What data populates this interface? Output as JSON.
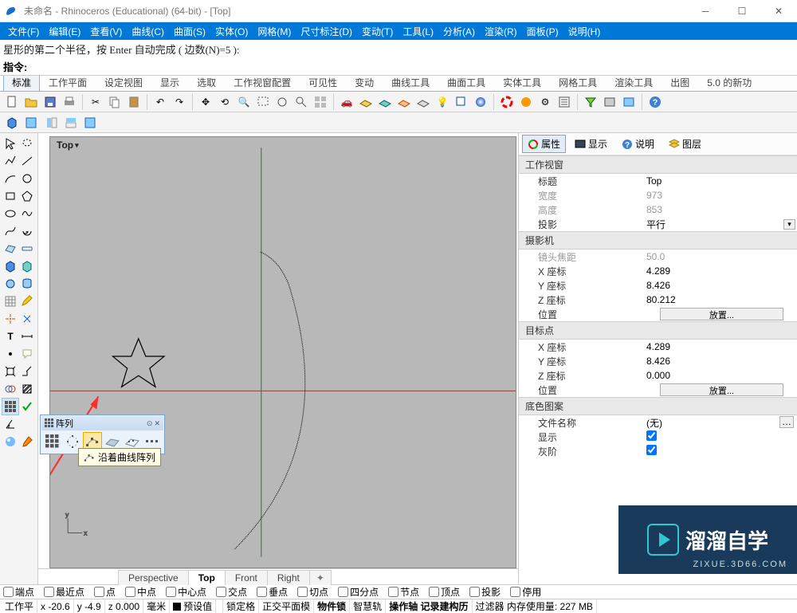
{
  "window": {
    "title": "未命名 - Rhinoceros (Educational) (64-bit) - [Top]"
  },
  "menu": [
    "文件(F)",
    "编辑(E)",
    "查看(V)",
    "曲线(C)",
    "曲面(S)",
    "实体(O)",
    "网格(M)",
    "尺寸标注(D)",
    "变动(T)",
    "工具(L)",
    "分析(A)",
    "渲染(R)",
    "面板(P)",
    "说明(H)"
  ],
  "command": {
    "prompt": "星形的第二个半径，按 Enter 自动完成 ( 边数(N)=5 ):",
    "label": "指令:"
  },
  "tabs": [
    "标准",
    "工作平面",
    "设定视图",
    "显示",
    "选取",
    "工作视窗配置",
    "可见性",
    "变动",
    "曲线工具",
    "曲面工具",
    "实体工具",
    "网格工具",
    "渲染工具",
    "出图",
    "5.0 的新功"
  ],
  "active_tab": 0,
  "viewport": {
    "label": "Top"
  },
  "view_tabs": [
    "Perspective",
    "Top",
    "Front",
    "Right"
  ],
  "active_view_tab": 1,
  "float_toolbar": {
    "title": "阵列",
    "tooltip": "沿着曲线阵列"
  },
  "right_panel": {
    "tabs": [
      "属性",
      "显示",
      "说明",
      "图层"
    ],
    "active": 0,
    "groups": [
      {
        "title": "工作视窗",
        "rows": [
          {
            "k": "标题",
            "v": "Top"
          },
          {
            "k": "宽度",
            "v": "973",
            "dim": true
          },
          {
            "k": "高度",
            "v": "853",
            "dim": true
          },
          {
            "k": "投影",
            "v": "平行",
            "combo": true
          }
        ]
      },
      {
        "title": "摄影机",
        "rows": [
          {
            "k": "镜头焦距",
            "v": "50.0",
            "dim": true
          },
          {
            "k": "X 座标",
            "v": "4.289"
          },
          {
            "k": "Y 座标",
            "v": "8.426"
          },
          {
            "k": "Z 座标",
            "v": "80.212"
          },
          {
            "k": "位置",
            "btn": "放置..."
          }
        ]
      },
      {
        "title": "目标点",
        "rows": [
          {
            "k": "X 座标",
            "v": "4.289"
          },
          {
            "k": "Y 座标",
            "v": "8.426"
          },
          {
            "k": "Z 座标",
            "v": "0.000"
          },
          {
            "k": "位置",
            "btn": "放置..."
          }
        ]
      },
      {
        "title": "底色图案",
        "rows": [
          {
            "k": "文件名称",
            "v": "(无)",
            "dots": true
          },
          {
            "k": "显示",
            "check": true
          },
          {
            "k": "灰阶",
            "check": true
          }
        ]
      }
    ]
  },
  "osnap": [
    "端点",
    "最近点",
    "点",
    "中点",
    "中心点",
    "交点",
    "垂点",
    "切点",
    "四分点",
    "节点",
    "顶点",
    "投影",
    "停用"
  ],
  "status": {
    "cells": [
      "工作平",
      "x -20.6",
      "y -4.9",
      "z 0.000",
      "毫米",
      "■预设值",
      "",
      "锁定格",
      "正交平面模",
      "物件锁",
      "智慧轨",
      "操作轴 记录建构历",
      "过滤器 内存使用量: 227 MB"
    ]
  },
  "watermark": {
    "text": "溜溜自学",
    "sub": "ZIXUE.3D66.COM"
  }
}
